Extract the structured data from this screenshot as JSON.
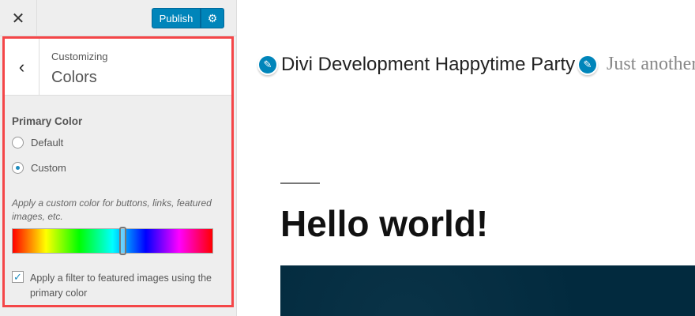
{
  "topbar": {
    "close_icon": "close-icon",
    "publish_label": "Publish",
    "gear_icon": "gear-icon"
  },
  "panel": {
    "breadcrumb": "Customizing",
    "title": "Colors",
    "back_icon": "chevron-left-icon",
    "primary_color_label": "Primary Color",
    "options": [
      {
        "label": "Default",
        "selected": false
      },
      {
        "label": "Custom",
        "selected": true
      }
    ],
    "description": "Apply a custom color for buttons, links, featured images, etc.",
    "hue_position": 0.55,
    "filter_checked": true,
    "filter_label": "Apply a filter to featured images using the primary color"
  },
  "preview": {
    "site_title": "Divi Development Happytime Party",
    "tagline": "Just another",
    "post_title": "Hello world!",
    "accent": "#0085ba"
  }
}
